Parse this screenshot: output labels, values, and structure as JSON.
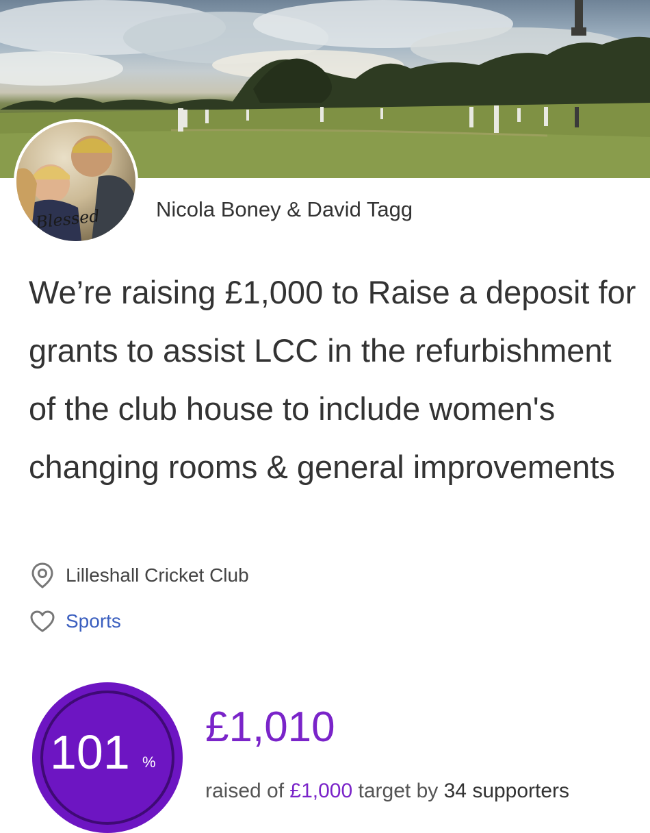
{
  "campaign": {
    "organisers": "Nicola Boney & David Tagg",
    "headline": "We’re raising £1,000 to Raise a deposit for grants to assist LCC in the refurbishment of the club house to include women's changing rooms & general improvements",
    "avatar_caption": "Blessed",
    "location": "Lilleshall Cricket Club",
    "category": "Sports"
  },
  "icons": {
    "location": "location-pin-icon",
    "category": "heart-icon"
  },
  "progress": {
    "percent_value": "101",
    "percent_sign": "%",
    "percent_fraction": 1.01,
    "raised_amount": "£1,010",
    "raised_prefix": "raised of",
    "target_amount": "£1,000",
    "target_middle": "target by",
    "supporters": "34 supporters"
  },
  "colors": {
    "accent": "#7a24c9",
    "ring_fill": "#6d15c2",
    "ring_track": "#3f0a75",
    "link": "#3b5fbf",
    "text": "#333333"
  }
}
